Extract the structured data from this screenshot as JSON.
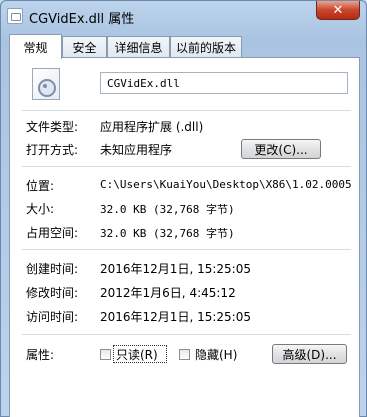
{
  "window": {
    "title": "CGVidEx.dll 属性",
    "close_glyph": "✕"
  },
  "tabs": [
    {
      "label": "常规",
      "active": true
    },
    {
      "label": "安全",
      "active": false
    },
    {
      "label": "详细信息",
      "active": false
    },
    {
      "label": "以前的版本",
      "active": false
    }
  ],
  "general": {
    "file_icon": "dll-file-icon",
    "file_name": "CGVidEx.dll",
    "file_type_label": "文件类型:",
    "file_type_value": "应用程序扩展 (.dll)",
    "opens_with_label": "打开方式:",
    "opens_with_value": "未知应用程序",
    "change_button": "更改(C)...",
    "location_label": "位置:",
    "location_value": "C:\\Users\\KuaiYou\\Desktop\\X86\\1.02.0005",
    "size_label": "大小:",
    "size_value": "32.0 KB (32,768 字节)",
    "size_on_disk_label": "占用空间:",
    "size_on_disk_value": "32.0 KB (32,768 字节)",
    "created_label": "创建时间:",
    "created_value": "2016年12月1日, 15:25:05",
    "modified_label": "修改时间:",
    "modified_value": "2012年1月6日, 4:45:12",
    "accessed_label": "访问时间:",
    "accessed_value": "2016年12月1日, 15:25:05",
    "attributes_label": "属性:",
    "readonly_label": "只读(R)",
    "hidden_label": "隐藏(H)",
    "advanced_button": "高级(D)..."
  },
  "colors": {
    "title_bar": "#bcd3ec",
    "close_button": "#c9462c"
  }
}
